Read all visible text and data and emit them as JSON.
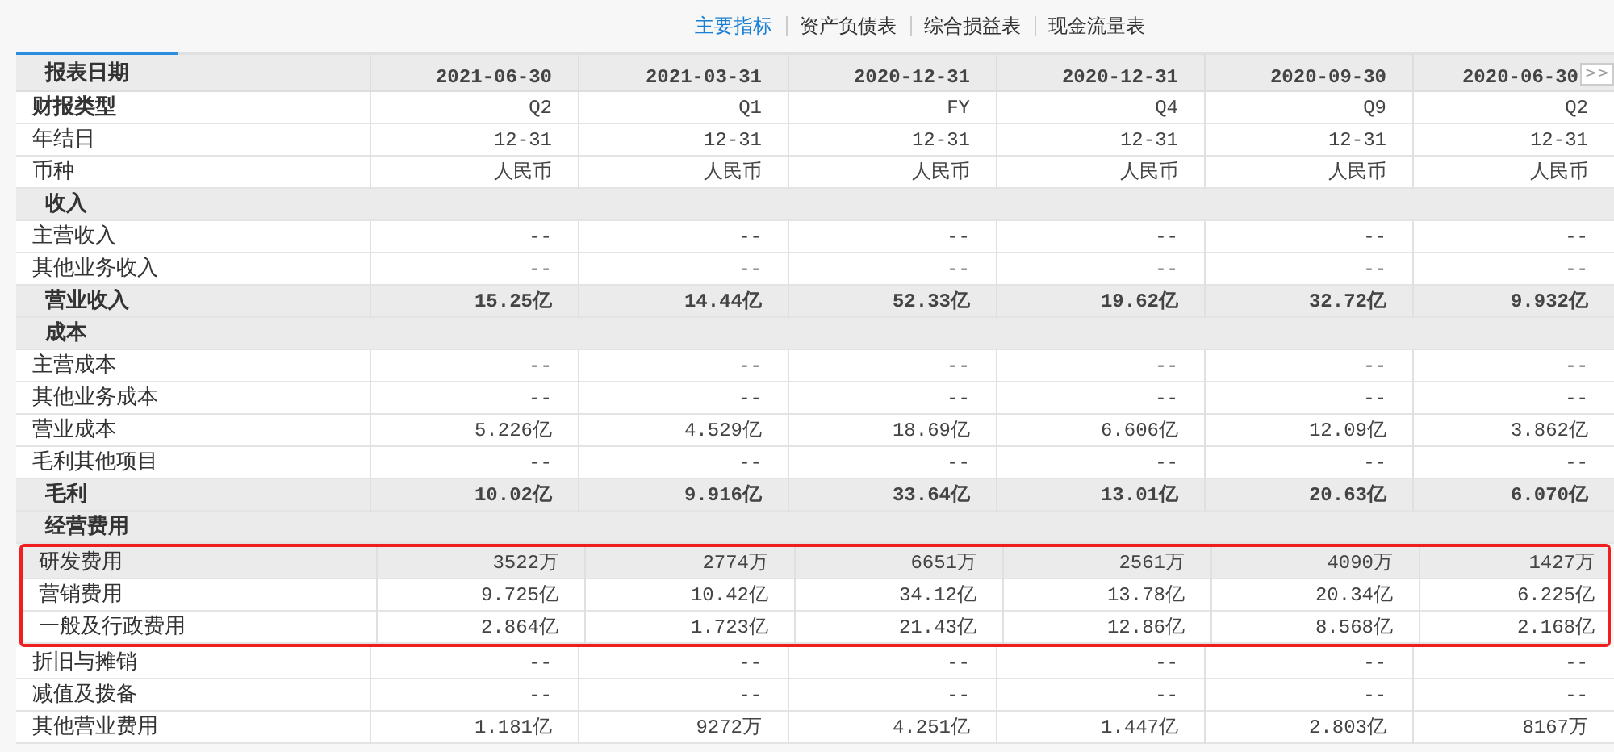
{
  "tabs": [
    {
      "label": "主要指标",
      "selected": true
    },
    {
      "label": "资产负债表",
      "selected": false
    },
    {
      "label": "综合损益表",
      "selected": false
    },
    {
      "label": "现金流量表",
      "selected": false
    }
  ],
  "table": {
    "header": {
      "label": "报表日期",
      "columns": [
        "2021-06-30",
        "2021-03-31",
        "2020-12-31",
        "2020-12-31",
        "2020-09-30",
        "2020-06-30"
      ]
    },
    "next_button": ">>",
    "rows": [
      {
        "kind": "meta",
        "label": "财报类型",
        "values": [
          "Q2",
          "Q1",
          "FY",
          "Q4",
          "Q9",
          "Q2"
        ],
        "highlighted": false
      },
      {
        "kind": "normal",
        "label": "年结日",
        "values": [
          "12-31",
          "12-31",
          "12-31",
          "12-31",
          "12-31",
          "12-31"
        ],
        "highlighted": false
      },
      {
        "kind": "normal",
        "label": "币种",
        "values": [
          "人民币",
          "人民币",
          "人民币",
          "人民币",
          "人民币",
          "人民币"
        ],
        "highlighted": false
      },
      {
        "kind": "section",
        "label": "收入",
        "values": [],
        "highlighted": false
      },
      {
        "kind": "normal",
        "label": "主营收入",
        "values": [
          "--",
          "--",
          "--",
          "--",
          "--",
          "--"
        ],
        "highlighted": false
      },
      {
        "kind": "normal",
        "label": "其他业务收入",
        "values": [
          "--",
          "--",
          "--",
          "--",
          "--",
          "--"
        ],
        "highlighted": false
      },
      {
        "kind": "total",
        "label": "营业收入",
        "values": [
          "15.25亿",
          "14.44亿",
          "52.33亿",
          "19.62亿",
          "32.72亿",
          "9.932亿"
        ],
        "highlighted": false
      },
      {
        "kind": "section",
        "label": "成本",
        "values": [],
        "highlighted": false
      },
      {
        "kind": "normal",
        "label": "主营成本",
        "values": [
          "--",
          "--",
          "--",
          "--",
          "--",
          "--"
        ],
        "highlighted": false
      },
      {
        "kind": "normal",
        "label": "其他业务成本",
        "values": [
          "--",
          "--",
          "--",
          "--",
          "--",
          "--"
        ],
        "highlighted": false
      },
      {
        "kind": "normal",
        "label": "营业成本",
        "values": [
          "5.226亿",
          "4.529亿",
          "18.69亿",
          "6.606亿",
          "12.09亿",
          "3.862亿"
        ],
        "highlighted": false
      },
      {
        "kind": "normal",
        "label": "毛利其他项目",
        "values": [
          "--",
          "--",
          "--",
          "--",
          "--",
          "--"
        ],
        "highlighted": false
      },
      {
        "kind": "total",
        "label": "毛利",
        "values": [
          "10.02亿",
          "9.916亿",
          "33.64亿",
          "13.01亿",
          "20.63亿",
          "6.070亿"
        ],
        "highlighted": false
      },
      {
        "kind": "section",
        "label": "经营费用",
        "values": [],
        "highlighted": false
      },
      {
        "kind": "hover",
        "label": "研发费用",
        "values": [
          "3522万",
          "2774万",
          "6651万",
          "2561万",
          "4090万",
          "1427万"
        ],
        "highlighted": true
      },
      {
        "kind": "normal",
        "label": "营销费用",
        "values": [
          "9.725亿",
          "10.42亿",
          "34.12亿",
          "13.78亿",
          "20.34亿",
          "6.225亿"
        ],
        "highlighted": true
      },
      {
        "kind": "normal",
        "label": "一般及行政费用",
        "values": [
          "2.864亿",
          "1.723亿",
          "21.43亿",
          "12.86亿",
          "8.568亿",
          "2.168亿"
        ],
        "highlighted": true
      },
      {
        "kind": "normal",
        "label": "折旧与摊销",
        "values": [
          "--",
          "--",
          "--",
          "--",
          "--",
          "--"
        ],
        "highlighted": false
      },
      {
        "kind": "normal",
        "label": "减值及拨备",
        "values": [
          "--",
          "--",
          "--",
          "--",
          "--",
          "--"
        ],
        "highlighted": false
      },
      {
        "kind": "normal",
        "label": "其他营业费用",
        "values": [
          "1.181亿",
          "9272万",
          "4.251亿",
          "1.447亿",
          "2.803亿",
          "8167万"
        ],
        "highlighted": false
      }
    ]
  }
}
